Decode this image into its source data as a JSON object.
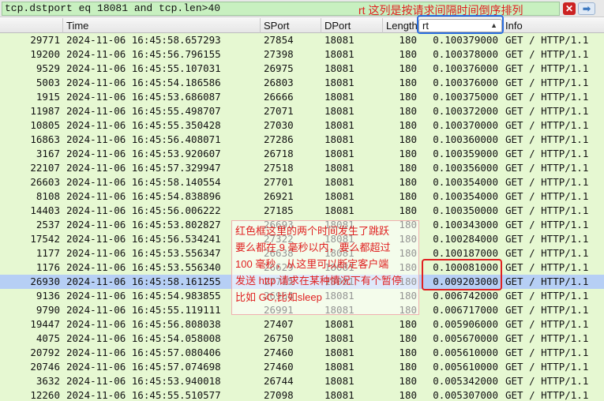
{
  "filter": {
    "text": "tcp.dstport eq 18081 and tcp.len>40",
    "clear_glyph": "✕",
    "apply_glyph": "➡"
  },
  "columns": {
    "time": "Time",
    "sport": "SPort",
    "dport": "DPort",
    "length": "Length",
    "rt": "rt",
    "info": "Info"
  },
  "annotations": {
    "header_note": "rt 这列是按请求间隔时间倒序排列",
    "note_lines": [
      "红色框这里的两个时间发生了跳跃",
      "要么都在 9 毫秒以内，要么都超过",
      "100 毫秒，从这里可以断定客户端",
      "发送 http 请求在某种情况下有个暂停",
      "比如 GC,比如sleep"
    ]
  },
  "colors": {
    "row_bg": "#e6f8d2",
    "selected_bg": "#b6cff5",
    "annotation_red": "#e02020",
    "highlight_blue": "#2a6de0"
  },
  "rows": [
    {
      "no": "29771",
      "time": "2024-11-06 16:45:58.657293",
      "sport": "27854",
      "dport": "18081",
      "len": "180",
      "rt": "0.100379000",
      "info": "GET / HTTP/1.1"
    },
    {
      "no": "19200",
      "time": "2024-11-06 16:45:56.796155",
      "sport": "27398",
      "dport": "18081",
      "len": "180",
      "rt": "0.100378000",
      "info": "GET / HTTP/1.1"
    },
    {
      "no": "9529",
      "time": "2024-11-06 16:45:55.107031",
      "sport": "26975",
      "dport": "18081",
      "len": "180",
      "rt": "0.100376000",
      "info": "GET / HTTP/1.1"
    },
    {
      "no": "5003",
      "time": "2024-11-06 16:45:54.186586",
      "sport": "26803",
      "dport": "18081",
      "len": "180",
      "rt": "0.100376000",
      "info": "GET / HTTP/1.1"
    },
    {
      "no": "1915",
      "time": "2024-11-06 16:45:53.686087",
      "sport": "26666",
      "dport": "18081",
      "len": "180",
      "rt": "0.100375000",
      "info": "GET / HTTP/1.1"
    },
    {
      "no": "11987",
      "time": "2024-11-06 16:45:55.498707",
      "sport": "27071",
      "dport": "18081",
      "len": "180",
      "rt": "0.100372000",
      "info": "GET / HTTP/1.1"
    },
    {
      "no": "10805",
      "time": "2024-11-06 16:45:55.350428",
      "sport": "27030",
      "dport": "18081",
      "len": "180",
      "rt": "0.100370000",
      "info": "GET / HTTP/1.1"
    },
    {
      "no": "16863",
      "time": "2024-11-06 16:45:56.408071",
      "sport": "27286",
      "dport": "18081",
      "len": "180",
      "rt": "0.100360000",
      "info": "GET / HTTP/1.1"
    },
    {
      "no": "3167",
      "time": "2024-11-06 16:45:53.920607",
      "sport": "26718",
      "dport": "18081",
      "len": "180",
      "rt": "0.100359000",
      "info": "GET / HTTP/1.1"
    },
    {
      "no": "22107",
      "time": "2024-11-06 16:45:57.329947",
      "sport": "27518",
      "dport": "18081",
      "len": "180",
      "rt": "0.100356000",
      "info": "GET / HTTP/1.1"
    },
    {
      "no": "26603",
      "time": "2024-11-06 16:45:58.140554",
      "sport": "27701",
      "dport": "18081",
      "len": "180",
      "rt": "0.100354000",
      "info": "GET / HTTP/1.1"
    },
    {
      "no": "8108",
      "time": "2024-11-06 16:45:54.838896",
      "sport": "26921",
      "dport": "18081",
      "len": "180",
      "rt": "0.100354000",
      "info": "GET / HTTP/1.1"
    },
    {
      "no": "14403",
      "time": "2024-11-06 16:45:56.006222",
      "sport": "27185",
      "dport": "18081",
      "len": "180",
      "rt": "0.100350000",
      "info": "GET / HTTP/1.1"
    },
    {
      "no": "2537",
      "time": "2024-11-06 16:45:53.802827",
      "sport": "26693",
      "dport": "18081",
      "len": "180",
      "rt": "0.100343000",
      "info": "GET / HTTP/1.1"
    },
    {
      "no": "17542",
      "time": "2024-11-06 16:45:56.534241",
      "sport": "27322",
      "dport": "18081",
      "len": "180",
      "rt": "0.100284000",
      "info": "GET / HTTP/1.1"
    },
    {
      "no": "1177",
      "time": "2024-11-06 16:45:53.556347",
      "sport": "26638",
      "dport": "18081",
      "len": "180",
      "rt": "0.100187000",
      "info": "GET / HTTP/1.1"
    },
    {
      "no": "1176",
      "time": "2024-11-06 16:45:53.556340",
      "sport": "26629",
      "dport": "18081",
      "len": "180",
      "rt": "0.100081000",
      "info": "GET / HTTP/1.1"
    },
    {
      "no": "26930",
      "time": "2024-11-06 16:45:58.161255",
      "sport": "27715",
      "dport": "18081",
      "len": "180",
      "rt": "0.009203000",
      "info": "GET / HTTP/1.1",
      "selected": true
    },
    {
      "no": "9136",
      "time": "2024-11-06 16:45:54.983855",
      "sport": "26964",
      "dport": "18081",
      "len": "180",
      "rt": "0.006742000",
      "info": "GET / HTTP/1.1"
    },
    {
      "no": "9790",
      "time": "2024-11-06 16:45:55.119111",
      "sport": "26991",
      "dport": "18081",
      "len": "180",
      "rt": "0.006717000",
      "info": "GET / HTTP/1.1"
    },
    {
      "no": "19447",
      "time": "2024-11-06 16:45:56.808038",
      "sport": "27407",
      "dport": "18081",
      "len": "180",
      "rt": "0.005906000",
      "info": "GET / HTTP/1.1"
    },
    {
      "no": "4075",
      "time": "2024-11-06 16:45:54.058008",
      "sport": "26750",
      "dport": "18081",
      "len": "180",
      "rt": "0.005670000",
      "info": "GET / HTTP/1.1"
    },
    {
      "no": "20792",
      "time": "2024-11-06 16:45:57.080406",
      "sport": "27460",
      "dport": "18081",
      "len": "180",
      "rt": "0.005610000",
      "info": "GET / HTTP/1.1"
    },
    {
      "no": "20746",
      "time": "2024-11-06 16:45:57.074698",
      "sport": "27460",
      "dport": "18081",
      "len": "180",
      "rt": "0.005610000",
      "info": "GET / HTTP/1.1"
    },
    {
      "no": "3632",
      "time": "2024-11-06 16:45:53.940018",
      "sport": "26744",
      "dport": "18081",
      "len": "180",
      "rt": "0.005342000",
      "info": "GET / HTTP/1.1"
    },
    {
      "no": "12260",
      "time": "2024-11-06 16:45:55.510577",
      "sport": "27098",
      "dport": "18081",
      "len": "180",
      "rt": "0.005307000",
      "info": "GET / HTTP/1.1"
    }
  ]
}
